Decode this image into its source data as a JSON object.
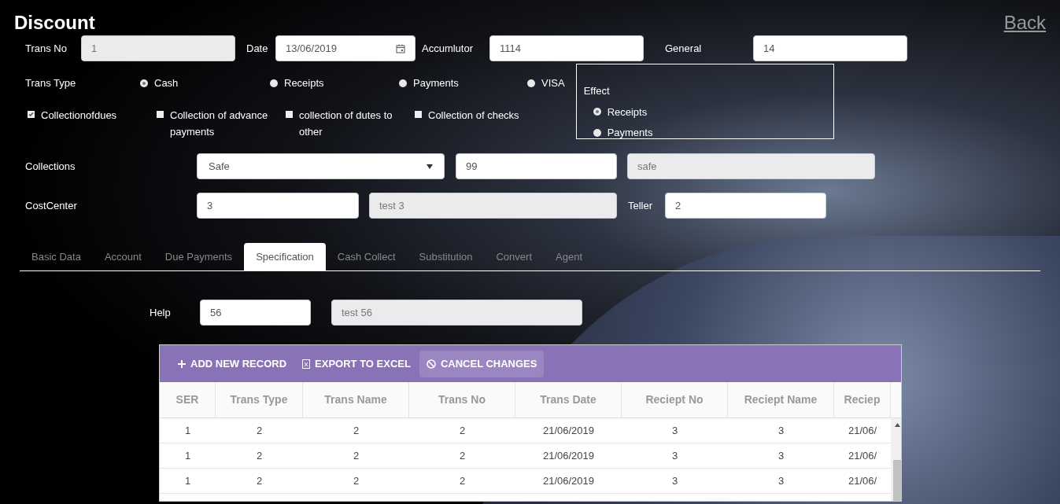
{
  "title": "Discount",
  "back_link": "Back",
  "row1": [
    {
      "label": "Trans No",
      "value": "1",
      "disabled": true,
      "kind": "text"
    },
    {
      "label": "Date",
      "value": "13/06/2019",
      "disabled": false,
      "kind": "date"
    },
    {
      "label": "Accumlutor",
      "value": "1114",
      "disabled": false,
      "kind": "text"
    },
    {
      "label": "General",
      "value": "14",
      "disabled": false,
      "kind": "text"
    }
  ],
  "trans_type": {
    "label": "Trans Type",
    "options": [
      {
        "label": "Cash",
        "selected": true
      },
      {
        "label": "Receipts",
        "selected": false
      },
      {
        "label": "Payments",
        "selected": false
      },
      {
        "label": "VISA",
        "selected": false
      }
    ]
  },
  "collection_checks": [
    {
      "label": "Collectionofdues",
      "checked": true
    },
    {
      "label": "Collection of advance payments",
      "checked": false
    },
    {
      "label": "collection of dutes to other",
      "checked": false
    },
    {
      "label": "Collection of checks",
      "checked": false
    }
  ],
  "effect": {
    "label": "Effect",
    "options": [
      {
        "label": "Receipts",
        "selected": true
      },
      {
        "label": "Payments",
        "selected": false
      }
    ]
  },
  "collections": {
    "label": "Collections",
    "select": "Safe",
    "code": {
      "value": "99",
      "disabled": false
    },
    "name": {
      "value": "safe",
      "disabled": true
    }
  },
  "cost_center": {
    "label": "CostCenter",
    "code": {
      "value": "3",
      "disabled": false
    },
    "name": {
      "value": "test 3",
      "disabled": true
    },
    "teller_label": "Teller",
    "teller": {
      "value": "2",
      "disabled": false
    }
  },
  "tabs": [
    {
      "label": "Basic Data",
      "selected": false
    },
    {
      "label": "Account",
      "selected": false
    },
    {
      "label": "Due Payments",
      "selected": false
    },
    {
      "label": "Specification",
      "selected": true
    },
    {
      "label": "Cash Collect",
      "selected": false
    },
    {
      "label": "Substitution",
      "selected": false
    },
    {
      "label": "Convert",
      "selected": false
    },
    {
      "label": "Agent",
      "selected": false
    }
  ],
  "help": {
    "label": "Help",
    "code": {
      "value": "56",
      "disabled": false
    },
    "name": {
      "value": "test 56",
      "disabled": true
    }
  },
  "toolbar": [
    {
      "label": "ADD NEW RECORD",
      "kind": "add",
      "selected": false
    },
    {
      "label": "EXPORT TO EXCEL",
      "kind": "export",
      "selected": false
    },
    {
      "label": "CANCEL CHANGES",
      "kind": "cancel",
      "selected": true
    }
  ],
  "table": {
    "columns": [
      "SER",
      "Trans Type",
      "Trans Name",
      "Trans No",
      "Trans Date",
      "Reciept No",
      "Reciept Name",
      "Reciep"
    ],
    "rows": [
      [
        "1",
        "2",
        "2",
        "2",
        "21/06/2019",
        "3",
        "3",
        "21/06/"
      ],
      [
        "1",
        "2",
        "2",
        "2",
        "21/06/2019",
        "3",
        "3",
        "21/06/"
      ],
      [
        "1",
        "2",
        "2",
        "2",
        "21/06/2019",
        "3",
        "3",
        "21/06/"
      ]
    ]
  }
}
